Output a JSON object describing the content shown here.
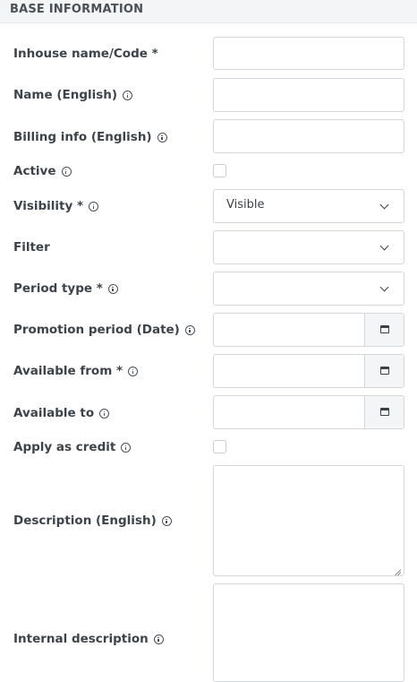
{
  "section": {
    "title": "BASE INFORMATION"
  },
  "fields": {
    "inhouse_code": {
      "label": "Inhouse name/Code *",
      "value": ""
    },
    "name_en": {
      "label": "Name (English)",
      "value": ""
    },
    "billing_en": {
      "label": "Billing info (English)",
      "value": ""
    },
    "active": {
      "label": "Active",
      "checked": false
    },
    "visibility": {
      "label": "Visibility *",
      "value": "Visible"
    },
    "filter": {
      "label": "Filter",
      "value": ""
    },
    "period_type": {
      "label": "Period type *",
      "value": ""
    },
    "promotion_period": {
      "label": "Promotion period (Date)",
      "value": ""
    },
    "available_from": {
      "label": "Available from *",
      "value": ""
    },
    "available_to": {
      "label": "Available to",
      "value": ""
    },
    "apply_credit": {
      "label": "Apply as credit",
      "checked": false
    },
    "description_en": {
      "label": "Description (English)",
      "value": ""
    },
    "internal_description": {
      "label": "Internal description",
      "value": ""
    }
  },
  "icons": {
    "info": "info-circle-icon",
    "select": "chevron-down-icon",
    "date": "calendar-icon"
  }
}
